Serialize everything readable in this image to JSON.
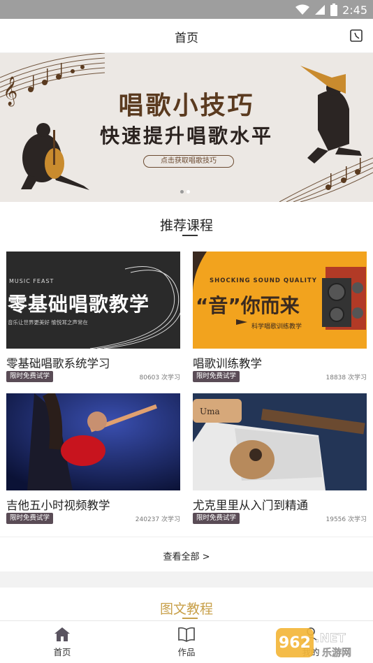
{
  "status_bar": {
    "time": "2:45"
  },
  "app_bar": {
    "title": "首页",
    "history_icon": "history-icon"
  },
  "banner": {
    "title": "唱歌小技巧",
    "subtitle": "快速提升唱歌水平",
    "button_label": "点击获取唱歌技巧",
    "page_count": 2,
    "active_page": 2
  },
  "recommended": {
    "title": "推荐课程",
    "courses": [
      {
        "name": "零基础唱歌系统学习",
        "badge": "限时免费试学",
        "count": "80603 次学习",
        "thumb_top": "MUSIC FEAST",
        "thumb_title": "零基础唱歌教学",
        "thumb_sub": "音乐让世界更美好   愉悦耳之声常在"
      },
      {
        "name": "唱歌训练教学",
        "badge": "限时免费试学",
        "count": "18838 次学习",
        "thumb_top": "SHOCKING SOUND QUALITY",
        "thumb_title": "“音”你而来",
        "thumb_sub": "科学唱歌训练教学"
      },
      {
        "name": "吉他五小时视频教学",
        "badge": "限时免费试学",
        "count": "240237 次学习"
      },
      {
        "name": "尤克里里从入门到精通",
        "badge": "限时免费试学",
        "count": "19556 次学习"
      }
    ],
    "view_all": "查看全部 >"
  },
  "articles": {
    "title": "图文教程"
  },
  "tab_bar": {
    "items": [
      {
        "label": "首页",
        "icon": "home-icon"
      },
      {
        "label": "作品",
        "icon": "book-icon"
      },
      {
        "label": "我的",
        "icon": "person-icon"
      }
    ]
  },
  "watermark": {
    "text_top": "962.NET",
    "text_bottom": "乐游网"
  },
  "colors": {
    "accent_gold": "#c8a04a",
    "badge_bg": "#5a4c56",
    "status_bar": "#9e9e9e"
  }
}
